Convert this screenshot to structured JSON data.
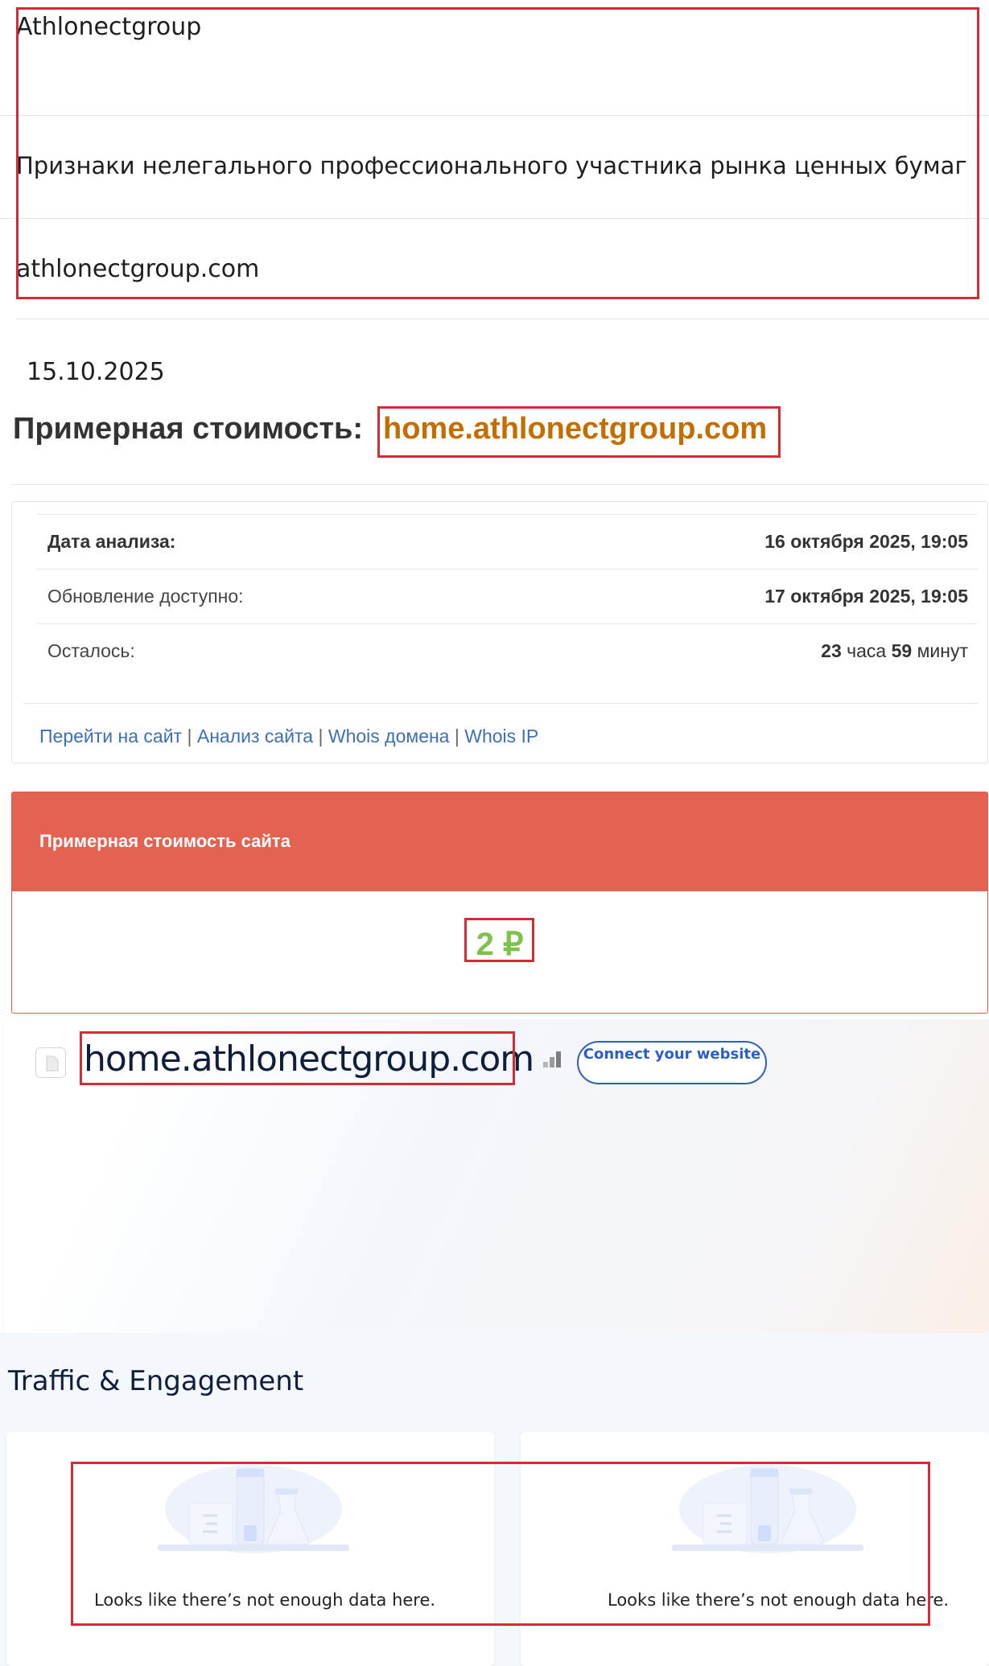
{
  "list": {
    "name": "Athlonectgroup",
    "description": "Признаки нелегального профессионального участника рынка ценных бумаг",
    "domain": "athlonectgroup.com"
  },
  "date": "15.10.2025",
  "page_heading": {
    "prefix": "Примерная стоимость:",
    "domain": "home.athlonectgroup.com"
  },
  "analysis": {
    "rows": [
      {
        "label": "Дата анализа:",
        "value": "16 октября 2025, 19:05"
      },
      {
        "label": "Обновление доступно:",
        "value": "17 октября 2025, 19:05"
      },
      {
        "label": "Осталось:",
        "hours": "23",
        "hours_unit": "часа",
        "minutes": "59",
        "minutes_unit": "минут"
      }
    ],
    "links": {
      "go_to_site": "Перейти на сайт",
      "site_analysis": "Анализ сайта",
      "whois_domain": "Whois домена",
      "whois_ip": "Whois IP",
      "separator": "|"
    }
  },
  "estimate": {
    "header": "Примерная стоимость сайта",
    "value": "2 ₽"
  },
  "similarweb": {
    "domain": "home.athlonectgroup.com",
    "connect_button": "Connect your website",
    "section_title": "Traffic & Engagement",
    "empty_text": "Looks like there’s not enough data here."
  },
  "colors": {
    "highlight_border": "#d42b35",
    "domain_orange": "#c46d00",
    "estimate_header": "#e46252",
    "estimate_value": "#7dc24b",
    "link_blue": "#3d6fb5",
    "button_blue": "#2d5ec6"
  }
}
